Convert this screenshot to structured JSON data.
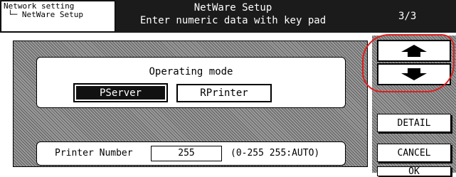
{
  "header": {
    "breadcrumb_line1": "Network setting",
    "breadcrumb_line2": "└─ NetWare Setup",
    "title": "NetWare Setup",
    "subtitle": "Enter numeric data with key pad",
    "page": "3/3"
  },
  "mode": {
    "label": "Operating mode",
    "options": [
      "PServer",
      "RPrinter"
    ],
    "selected": "PServer"
  },
  "printer": {
    "label": "Printer Number",
    "value": "255",
    "range": "(0-255 255:AUTO)"
  },
  "buttons": {
    "detail": "DETAIL",
    "cancel": "CANCEL",
    "ok": "OK"
  },
  "colors": {
    "header_bg": "#1b1b1b",
    "hatch": "#9b9b9b",
    "highlight": "#e31c1c"
  }
}
